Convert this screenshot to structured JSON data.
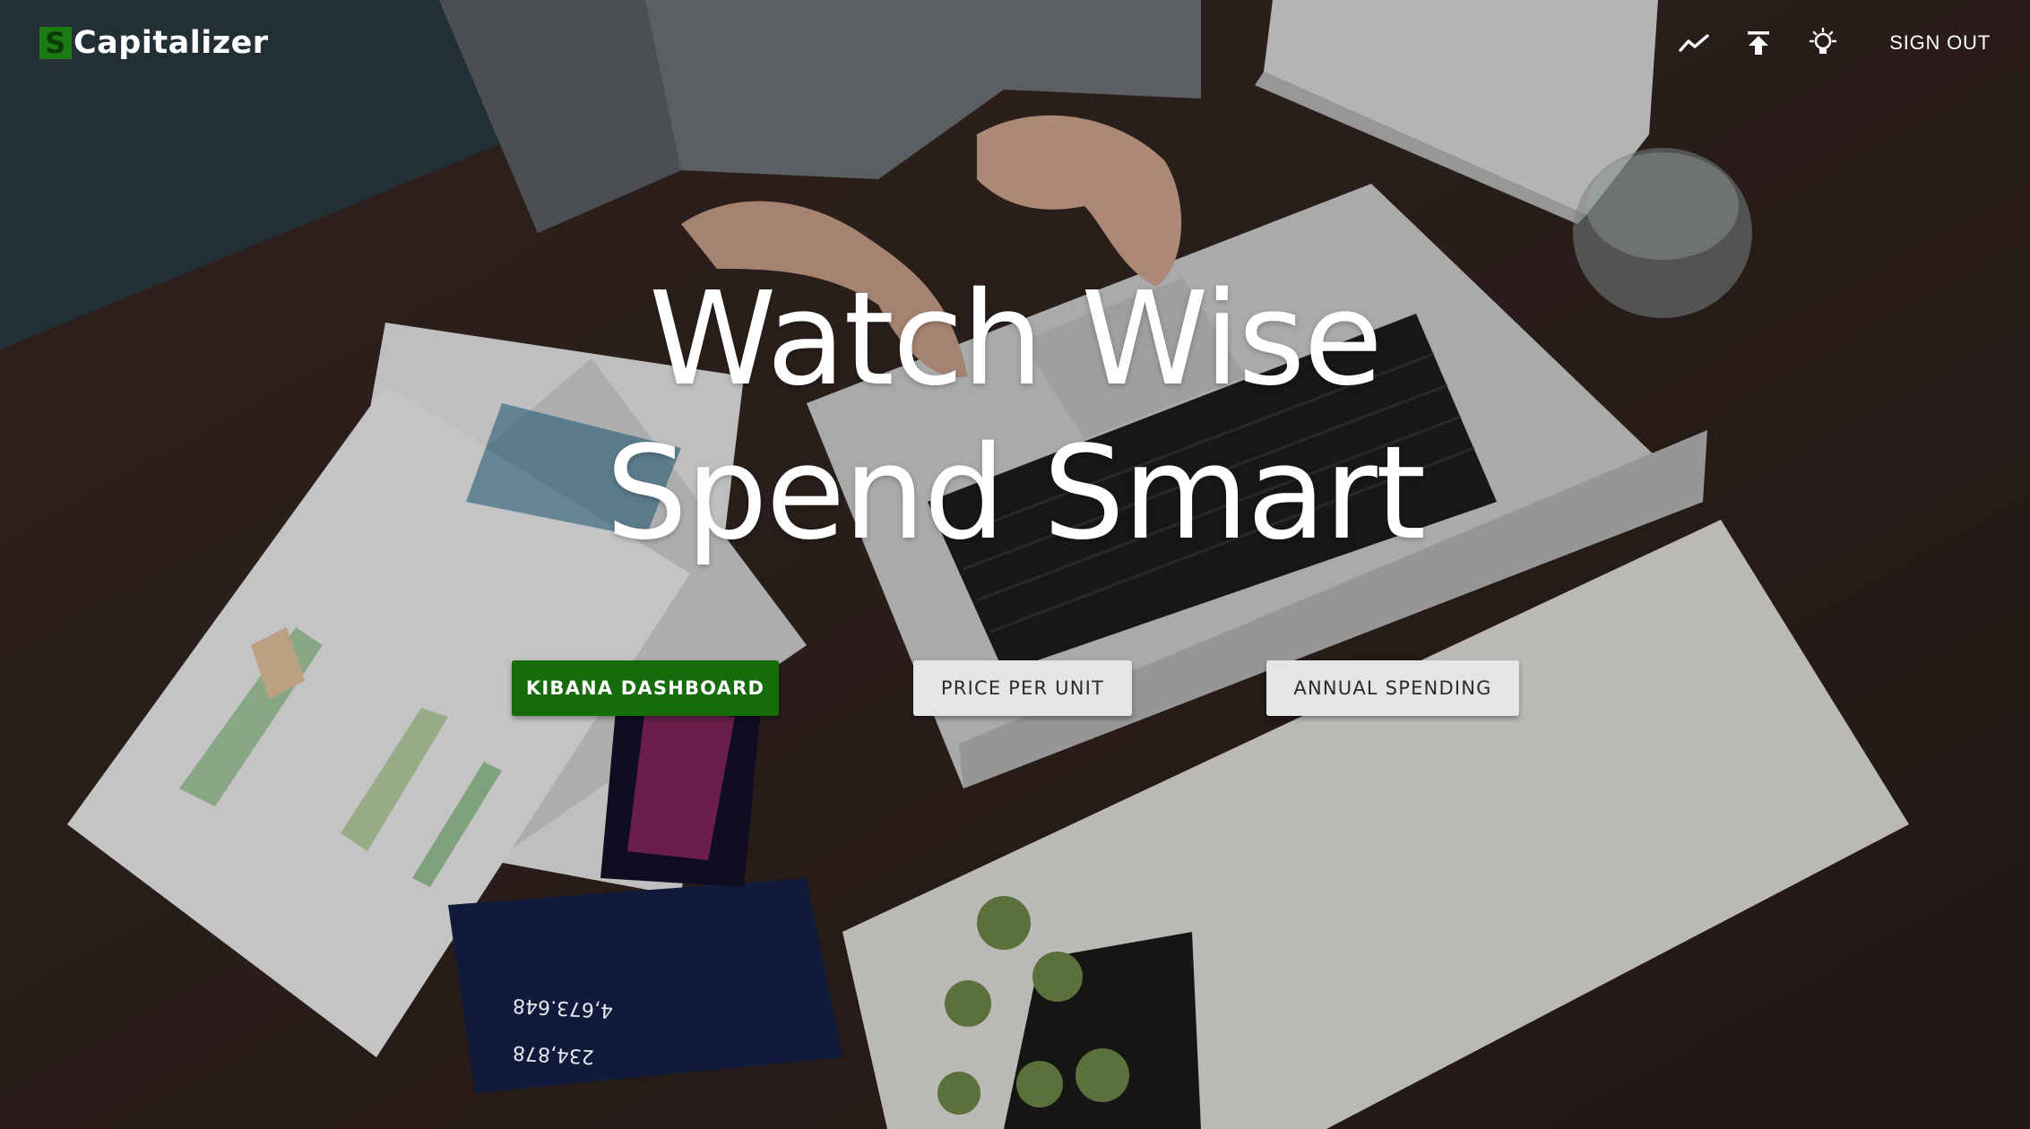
{
  "brand": {
    "mark": "S",
    "name": "Capitalizer",
    "accent": "#1c7a12"
  },
  "nav": {
    "icons": [
      "trending-up-icon",
      "upload-icon",
      "lightbulb-icon"
    ],
    "sign_out": "SIGN OUT"
  },
  "hero": {
    "line1": "Watch Wise",
    "line2": "Spend Smart",
    "background_numbers": [
      "4,673.648",
      "234,878"
    ]
  },
  "buttons": {
    "kibana": "KIBANA DASHBOARD",
    "price_per_unit": "PRICE PER UNIT",
    "annual_spending": "ANNUAL SPENDING"
  },
  "colors": {
    "primary_button": "#166b0b",
    "secondary_button": "#e5e5e5",
    "text_light": "#ffffff"
  }
}
